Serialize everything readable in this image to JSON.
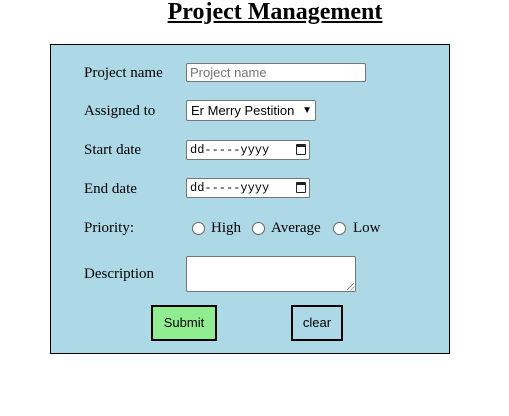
{
  "page": {
    "title": "Project Management"
  },
  "form": {
    "project_name": {
      "label": "Project name",
      "placeholder": "Project name",
      "value": ""
    },
    "assigned_to": {
      "label": "Assigned to",
      "selected": "Er Merry Pestition"
    },
    "start_date": {
      "label": "Start date",
      "value": "dd-----yyyy"
    },
    "end_date": {
      "label": "End date",
      "value": "dd-----yyyy"
    },
    "priority": {
      "label": "Priority:",
      "options": [
        "High",
        "Average",
        "Low"
      ]
    },
    "description": {
      "label": "Description",
      "value": ""
    },
    "buttons": {
      "submit_label": "Submit",
      "clear_label": "clear"
    }
  },
  "colors": {
    "form_background": "#add8e6",
    "submit_background": "#90ee90",
    "clear_background": "#add8e6"
  },
  "icons": {
    "select": "chevron-down-icon",
    "date": "calendar-icon"
  }
}
